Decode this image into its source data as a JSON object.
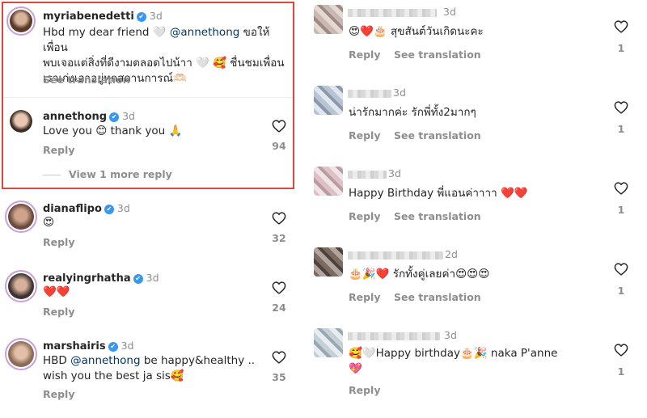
{
  "left": {
    "thread": {
      "username": "myriabenedetti",
      "time": "3d",
      "text_line1_prefix": "Hbd my dear friend ",
      "text_line1_heart": "🤍",
      "text_mention": "@annethong",
      "text_line1_suffix": " ขอให้เพื่อน",
      "text_line2": "พบเจอแต่สิ่งที่ดีงามตลอดไปน้าา 🤍 🥰 ชื่นชมเพื่อน",
      "text_line3": "เราเก่งเอาอยู่ทุกสถานการณ์🫶🏻",
      "see_translation": "See translation"
    },
    "reply": {
      "username": "annethong",
      "time": "3d",
      "text": "Love you 😊 thank you 🙏",
      "action": "Reply",
      "likes": "94",
      "view_more": "View 1 more reply"
    },
    "comments": [
      {
        "username": "dianaflipo",
        "time": "3d",
        "text": "😍",
        "action": "Reply",
        "likes": "32",
        "avatar_color": "#6b4a3e"
      },
      {
        "username": "realyingrhatha",
        "time": "3d",
        "text": "❤️❤️",
        "action": "Reply",
        "likes": "24",
        "avatar_color": "#3b3330"
      },
      {
        "username": "marshairis",
        "time": "3d",
        "text_prefix": "HBD ",
        "mention": "@annethong",
        "text_suffix": " be happy&healthy ..",
        "text_line2": "wish you the best ja sis🥰",
        "action": "Reply",
        "likes": "35",
        "avatar_color": "#8a6a58"
      }
    ]
  },
  "right": {
    "comments": [
      {
        "time": "3d",
        "text": "😍❤️🎂 สุขสันต์วันเกิดนะคะ",
        "reply": "Reply",
        "see_translation": "See translation",
        "likes": "1"
      },
      {
        "time": "3d",
        "text": "น่ารักมากค่ะ รักพี่ทั้ง2มากๆ",
        "reply": "Reply",
        "see_translation": "See translation",
        "likes": "1"
      },
      {
        "time": "3d",
        "text": "Happy Birthday พี่แอนค่าาาา ❤️❤️",
        "reply": "Reply",
        "see_translation": "See translation",
        "likes": "1"
      },
      {
        "time": "2d",
        "text": "🎂🎉❤️ รักทั้งคู่เลยค่า😍😍😍",
        "reply": "Reply",
        "see_translation": "See translation",
        "likes": "1"
      },
      {
        "time": "3d",
        "text_line1": "🥰🤍Happy birthday🎂🎉 naka P'anne",
        "text_line2": "💖",
        "reply": "Reply",
        "likes": "1"
      }
    ]
  },
  "colors": {
    "accent_blue": "#3897f0",
    "highlight_red": "#e0453a",
    "muted": "#8e8e8e",
    "mention": "#00376b"
  },
  "icons": {
    "like": "heart-outline-icon",
    "verified": "verified-badge-icon"
  }
}
